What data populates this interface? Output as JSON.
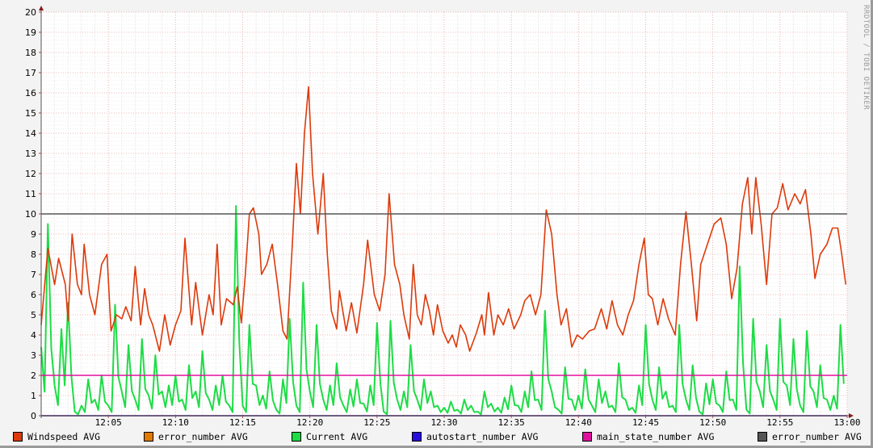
{
  "watermark": "RRDTOOL / TOBI OETIKER",
  "chart_data": {
    "type": "line",
    "title": "",
    "xlabel": "",
    "ylabel": "",
    "ylim": [
      0,
      20
    ],
    "yticks": [
      "0",
      "1",
      "2",
      "3",
      "4",
      "5",
      "6",
      "7",
      "8",
      "9",
      "10",
      "11",
      "12",
      "13",
      "14",
      "15",
      "16",
      "17",
      "18",
      "19",
      "20"
    ],
    "xlim_minutes": [
      0,
      60
    ],
    "xtick_labels": [
      {
        "min": 5,
        "label": "12:05"
      },
      {
        "min": 10,
        "label": "12:10"
      },
      {
        "min": 15,
        "label": "12:15"
      },
      {
        "min": 20,
        "label": "12:20"
      },
      {
        "min": 25,
        "label": "12:25"
      },
      {
        "min": 30,
        "label": "12:30"
      },
      {
        "min": 35,
        "label": "12:35"
      },
      {
        "min": 40,
        "label": "12:40"
      },
      {
        "min": 45,
        "label": "12:45"
      },
      {
        "min": 50,
        "label": "12:50"
      },
      {
        "min": 55,
        "label": "12:55"
      },
      {
        "min": 60,
        "label": "13:00"
      }
    ],
    "grid": true,
    "legend_position": "bottom",
    "series": [
      {
        "name": "Windspeed AVG",
        "color": "#dd3a0b",
        "kind": "xy",
        "points": [
          [
            0,
            4.5
          ],
          [
            0.5,
            8.3
          ],
          [
            1,
            6.5
          ],
          [
            1.3,
            7.8
          ],
          [
            1.8,
            6.5
          ],
          [
            2,
            4.7
          ],
          [
            2.3,
            9
          ],
          [
            2.7,
            6.5
          ],
          [
            3,
            6
          ],
          [
            3.2,
            8.5
          ],
          [
            3.6,
            6
          ],
          [
            4,
            5
          ],
          [
            4.5,
            7.5
          ],
          [
            4.9,
            8
          ],
          [
            5.2,
            4.2
          ],
          [
            5.6,
            5
          ],
          [
            6,
            4.8
          ],
          [
            6.3,
            5.4
          ],
          [
            6.7,
            4.7
          ],
          [
            7,
            7.4
          ],
          [
            7.4,
            4.5
          ],
          [
            7.7,
            6.3
          ],
          [
            8,
            5
          ],
          [
            8.3,
            4.5
          ],
          [
            8.8,
            3.2
          ],
          [
            9.2,
            5
          ],
          [
            9.6,
            3.5
          ],
          [
            10,
            4.5
          ],
          [
            10.4,
            5.2
          ],
          [
            10.7,
            8.8
          ],
          [
            11.2,
            4.5
          ],
          [
            11.5,
            6.6
          ],
          [
            12,
            4
          ],
          [
            12.5,
            6
          ],
          [
            12.8,
            5
          ],
          [
            13.1,
            8.5
          ],
          [
            13.4,
            4.5
          ],
          [
            13.8,
            5.8
          ],
          [
            14.3,
            5.5
          ],
          [
            14.6,
            6.4
          ],
          [
            14.9,
            4.6
          ],
          [
            15.2,
            7
          ],
          [
            15.5,
            10
          ],
          [
            15.8,
            10.3
          ],
          [
            16.2,
            9
          ],
          [
            16.4,
            7
          ],
          [
            16.8,
            7.5
          ],
          [
            17.2,
            8.5
          ],
          [
            17.6,
            6.5
          ],
          [
            18,
            4.2
          ],
          [
            18.3,
            3.8
          ],
          [
            18.7,
            8.5
          ],
          [
            19,
            12.5
          ],
          [
            19.3,
            10
          ],
          [
            19.6,
            14
          ],
          [
            19.9,
            16.3
          ],
          [
            20.2,
            12
          ],
          [
            20.6,
            9
          ],
          [
            21,
            12
          ],
          [
            21.3,
            8
          ],
          [
            21.6,
            5.2
          ],
          [
            22,
            4.3
          ],
          [
            22.2,
            6.2
          ],
          [
            22.7,
            4.2
          ],
          [
            23.1,
            5.6
          ],
          [
            23.5,
            4.1
          ],
          [
            24,
            6.5
          ],
          [
            24.3,
            8.7
          ],
          [
            24.8,
            6
          ],
          [
            25.2,
            5.2
          ],
          [
            25.6,
            7
          ],
          [
            25.9,
            11
          ],
          [
            26.3,
            7.5
          ],
          [
            26.7,
            6.5
          ],
          [
            27,
            5
          ],
          [
            27.4,
            3.8
          ],
          [
            27.7,
            7.5
          ],
          [
            28,
            5
          ],
          [
            28.3,
            4.5
          ],
          [
            28.6,
            6
          ],
          [
            28.9,
            5.2
          ],
          [
            29.2,
            4
          ],
          [
            29.5,
            5.5
          ],
          [
            29.9,
            4.2
          ],
          [
            30.3,
            3.6
          ],
          [
            30.6,
            4
          ],
          [
            30.9,
            3.4
          ],
          [
            31.2,
            4.5
          ],
          [
            31.6,
            4
          ],
          [
            31.9,
            3.2
          ],
          [
            32.4,
            4.1
          ],
          [
            32.8,
            5
          ],
          [
            33,
            4
          ],
          [
            33.3,
            6.1
          ],
          [
            33.7,
            4
          ],
          [
            34,
            5
          ],
          [
            34.4,
            4.5
          ],
          [
            34.8,
            5.3
          ],
          [
            35.2,
            4.3
          ],
          [
            35.7,
            5
          ],
          [
            36,
            5.7
          ],
          [
            36.4,
            6
          ],
          [
            36.8,
            5
          ],
          [
            37.2,
            6
          ],
          [
            37.6,
            10.2
          ],
          [
            38,
            9
          ],
          [
            38.4,
            6
          ],
          [
            38.7,
            4.5
          ],
          [
            39.1,
            5.3
          ],
          [
            39.5,
            3.4
          ],
          [
            39.9,
            4
          ],
          [
            40.3,
            3.8
          ],
          [
            40.8,
            4.2
          ],
          [
            41.2,
            4.3
          ],
          [
            41.7,
            5.3
          ],
          [
            42.1,
            4.3
          ],
          [
            42.5,
            5.7
          ],
          [
            42.9,
            4.5
          ],
          [
            43.3,
            4
          ],
          [
            43.7,
            5
          ],
          [
            44.1,
            5.7
          ],
          [
            44.5,
            7.5
          ],
          [
            44.9,
            8.8
          ],
          [
            45.2,
            6
          ],
          [
            45.5,
            5.8
          ],
          [
            45.9,
            4.5
          ],
          [
            46.3,
            5.8
          ],
          [
            46.7,
            4.8
          ],
          [
            47.2,
            4
          ],
          [
            47.6,
            7.5
          ],
          [
            48,
            10.1
          ],
          [
            48.4,
            7.5
          ],
          [
            48.8,
            4.7
          ],
          [
            49.1,
            7.5
          ],
          [
            49.6,
            8.5
          ],
          [
            50.1,
            9.5
          ],
          [
            50.6,
            9.8
          ],
          [
            51,
            8.5
          ],
          [
            51.4,
            5.8
          ],
          [
            51.8,
            7.3
          ],
          [
            52.2,
            10.5
          ],
          [
            52.6,
            11.8
          ],
          [
            52.9,
            9
          ],
          [
            53.2,
            11.8
          ],
          [
            53.6,
            9.5
          ],
          [
            54,
            6.5
          ],
          [
            54.4,
            10
          ],
          [
            54.8,
            10.3
          ],
          [
            55.2,
            11.5
          ],
          [
            55.6,
            10.2
          ],
          [
            56.1,
            11
          ],
          [
            56.5,
            10.5
          ],
          [
            56.9,
            11.2
          ],
          [
            57.3,
            9
          ],
          [
            57.6,
            6.8
          ],
          [
            58,
            8
          ],
          [
            58.5,
            8.5
          ],
          [
            58.9,
            9.3
          ],
          [
            59.3,
            9.3
          ],
          [
            59.6,
            8
          ],
          [
            59.9,
            6.5
          ]
        ]
      },
      {
        "name": "error_number AVG",
        "color": "#e07b00",
        "kind": "constant",
        "value": 0
      },
      {
        "name": "Current AVG",
        "color": "#1ddc45",
        "kind": "halfminute",
        "values": [
          3.4,
          9.5,
          1.5,
          4.3,
          5.6,
          0.2,
          0.5,
          1.8,
          0.8,
          2,
          0.5,
          5.5,
          1.2,
          3.5,
          0.8,
          3.8,
          1,
          3,
          1.2,
          1.5,
          2,
          0.8,
          2.5,
          1.2,
          3.2,
          0.8,
          1.5,
          2,
          0.5,
          10.4,
          0.5,
          4.5,
          1.5,
          1,
          2.2,
          0.3,
          1.8,
          4.8,
          0.5,
          6.6,
          1.2,
          4.5,
          0.8,
          1.5,
          2.6,
          0.5,
          1.3,
          1.8,
          0.6,
          1.5,
          4.6,
          0.2,
          4.7,
          0.8,
          1.2,
          3.5,
          0.8,
          1.8,
          1.2,
          0.5,
          0.4,
          0.7,
          0.3,
          0.8,
          0.5,
          0.2,
          1.2,
          0.6,
          0.4,
          0.9,
          1.5,
          0.5,
          1.2,
          2.2,
          0.8,
          5.2,
          1.2,
          0.3,
          2.4,
          0.8,
          1,
          2.3,
          0.5,
          1.8,
          1.2,
          0.5,
          2.6,
          0.8,
          0.4,
          1.5,
          4.5,
          0.8,
          2.4,
          1.2,
          0.5,
          4.5,
          0.8,
          2.5,
          0.2,
          1.6,
          1.8,
          0.5,
          2.2,
          0.8,
          7.4,
          0.3,
          4.8,
          1.2,
          3.5,
          0.8,
          4.8,
          1.5,
          3.8,
          0.5,
          4.2,
          1.2,
          2.5,
          0.8,
          1,
          4.5
        ]
      },
      {
        "name": "autostart_number AVG",
        "color": "#2a0fdc",
        "kind": "constant",
        "value": 0
      },
      {
        "name": "main_state_number AVG",
        "color": "#e0109e",
        "kind": "constant",
        "value": 2
      },
      {
        "name": "error_number AVG",
        "color": "#555555",
        "kind": "constant",
        "value": 10
      }
    ]
  }
}
